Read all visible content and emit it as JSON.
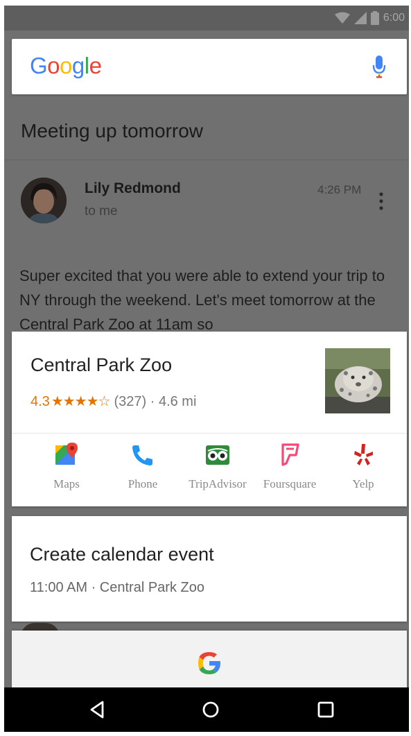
{
  "status_bar": {
    "time": "6:00",
    "icons": [
      "wifi-icon",
      "signal-icon",
      "battery-icon"
    ]
  },
  "search": {
    "logo": "Google",
    "mic_icon": "mic-icon"
  },
  "email": {
    "subject": "Meeting up tomorrow",
    "sender": "Lily Redmond",
    "recipient": "to me",
    "time": "4:26 PM",
    "body": "Super excited that you were able to extend your trip to NY through the weekend. Let's meet tomorrow at the Central Park Zoo at 11am so"
  },
  "place_card": {
    "name": "Central Park Zoo",
    "rating": "4.3",
    "stars_display": "★★★★☆",
    "rating_value": 4.3,
    "reviews": "(327)",
    "distance": "· 4.6 mi",
    "apps": [
      {
        "label": "Maps",
        "icon": "maps-icon"
      },
      {
        "label": "Phone",
        "icon": "phone-icon"
      },
      {
        "label": "TripAdvisor",
        "icon": "tripadvisor-icon"
      },
      {
        "label": "Foursquare",
        "icon": "foursquare-icon"
      },
      {
        "label": "Yelp",
        "icon": "yelp-icon"
      }
    ]
  },
  "calendar_card": {
    "title": "Create calendar event",
    "details": "11:00 AM · Central Park Zoo"
  },
  "bottom_bar": {
    "icon": "google-g-icon"
  },
  "nav": {
    "back": "back-icon",
    "home": "home-icon",
    "recents": "recents-icon"
  },
  "colors": {
    "google_blue": "#4285F4",
    "google_red": "#EA4335",
    "google_yellow": "#FBBC05",
    "google_green": "#34A853",
    "rating_orange": "#E37400"
  }
}
